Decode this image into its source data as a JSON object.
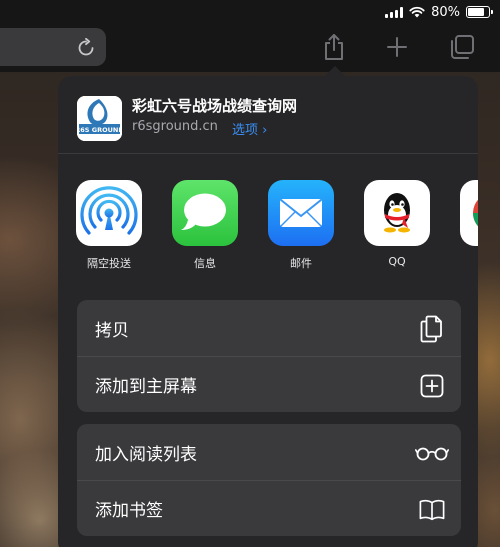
{
  "status_bar": {
    "battery_label": "80%",
    "battery_level": 0.8
  },
  "share_sheet": {
    "site": {
      "title": "彩虹六号战场战绩查询网",
      "url": "r6sground.cn",
      "options_link": "选项 ›",
      "icon_text": "R6S GROUND"
    },
    "apps": [
      {
        "label": "隔空投送",
        "icon": "airdrop-icon"
      },
      {
        "label": "信息",
        "icon": "messages-icon"
      },
      {
        "label": "邮件",
        "icon": "mail-icon"
      },
      {
        "label": "QQ",
        "icon": "qq-icon"
      },
      {
        "label": "C",
        "icon": "chrome-icon"
      }
    ],
    "action_group_1": [
      {
        "label": "拷贝",
        "icon": "copy-icon"
      },
      {
        "label": "添加到主屏幕",
        "icon": "add-square-icon"
      }
    ],
    "action_group_2": [
      {
        "label": "加入阅读列表",
        "icon": "reading-glasses-icon"
      },
      {
        "label": "添加书签",
        "icon": "book-icon"
      }
    ]
  },
  "colors": {
    "accent_link": "#3a8ff5",
    "sheet_bg": "#262628",
    "row_bg": "#3a3a3c"
  }
}
